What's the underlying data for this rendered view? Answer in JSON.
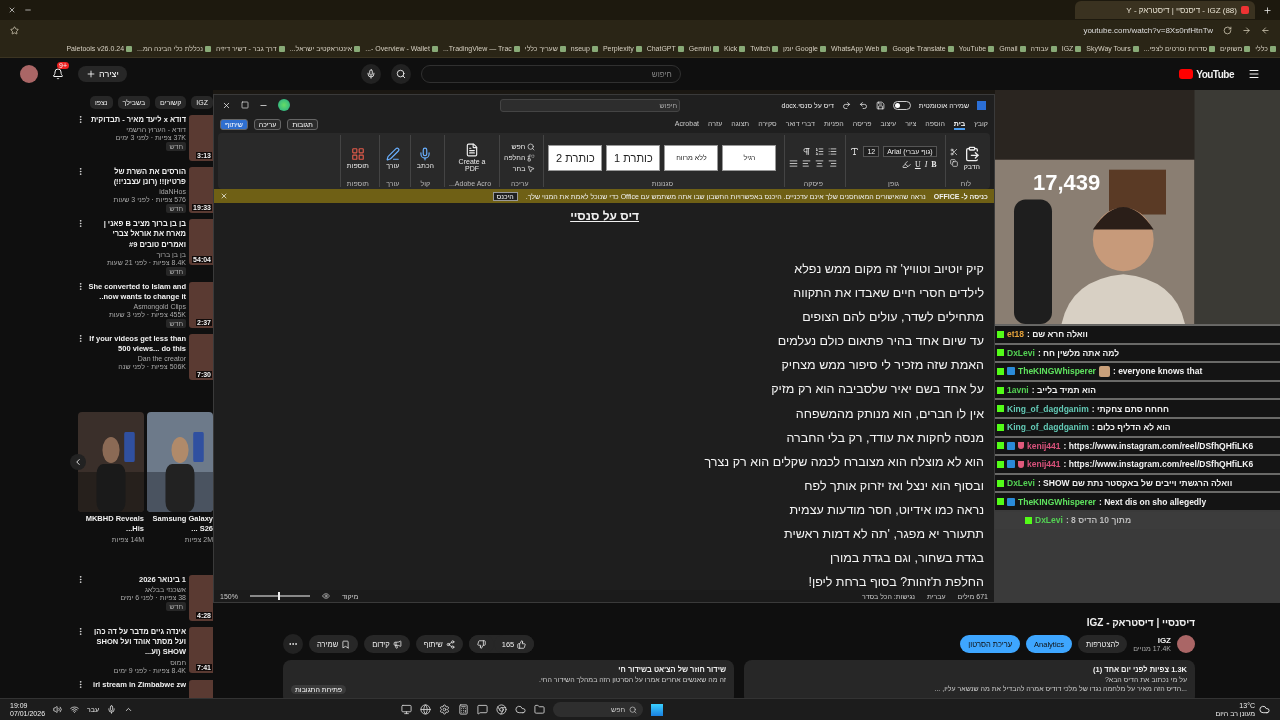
{
  "browser": {
    "tab_title": "(88) IGZ - דיסנסיי | דיסטראק - Y",
    "url": "youtube.com/watch?v=8Xs0nfHtnTw",
    "bookmarks": [
      "כללי",
      "משוקים",
      "סדרות וסרטים לצפי...",
      "SkyWay Tours",
      "IGZ",
      "עבודה",
      "Gmail",
      "YouTube",
      "Google Translate",
      "WhatsApp Web",
      "Google יומן",
      "Twitch",
      "Kick",
      "Gemini",
      "ChatGPT",
      "Perplexity",
      "nseup",
      "שעריך כללי",
      "TradingView — Trac...",
      "Overview - Wallet -...",
      "אינטראקטיב ישראל...",
      "דרך גבר - דשיר דיזיה",
      "נכללת כלי הבינה המ...",
      "Paletools v26.0.24"
    ]
  },
  "youtube_header": {
    "create_label": "יצירה",
    "notification_count": "9+",
    "search_placeholder": "חיפוש",
    "logo": "YouTube"
  },
  "sidebar": {
    "chips": [
      "IGZ",
      "קשורים",
      "בשבילך",
      "נצפו"
    ],
    "videos": [
      {
        "title": "דודא x ליעד מאיר - תבדוקית",
        "channel": "דודא - הערוץ הרשמי",
        "meta": "37K צפיות · לפני 3 ימים",
        "badge": "חדש",
        "duration": "3:13"
      },
      {
        "title": "הורסים את השרת של פרטיזן!! (רונן עצבני!!)",
        "channel": "idaNHos",
        "meta": "576 צפיות · לפני 3 שעות",
        "badge": "חדש",
        "duration": "19:33"
      },
      {
        "title": "בן בן ברוך מציב B פאני | מארח את אוראל צברי ואמרים טובים #9",
        "channel": "בן בן ברוך",
        "meta": "8.4K צפיות · לפני 21 שעות",
        "badge": "חדש",
        "duration": "54:04"
      },
      {
        "title": "She converted to Islam and now wants to change it..",
        "channel": "Asmongold Clips",
        "meta": "455K צפיות · לפני 3 שעות",
        "badge": "חדש",
        "duration": "2:37"
      },
      {
        "title": "If your videos get less than 500 views... do this",
        "channel": "Dan the creator",
        "meta": "506K צפיות · לפני שנה",
        "duration": "7:30"
      }
    ],
    "shorts": [
      {
        "title": "Samsung Galaxy S26 ...",
        "meta": "2M צפיות"
      },
      {
        "title": "MKBHD Reveals His...",
        "meta": "14M צפיות"
      }
    ],
    "videos_after": [
      {
        "title": "1 בינואר 2026",
        "channel": "אשכנזי בבלאג",
        "meta": "38 צפיות · לפני 6 ימים",
        "badge": "חדש",
        "duration": "4:28"
      },
      {
        "title": "אינדה גיים מדבר על דה כהן ועל מסתר אוהד ועל SHON SHOW (וע...",
        "channel": "חמוס",
        "meta": "8.4K צפיות · לפני 9 ימים",
        "duration": "7:41"
      },
      {
        "title": "irl stream in Zimbabwe zw"
      }
    ]
  },
  "word": {
    "autosave": {
      "label": "שמירה אוטומטית",
      "on": false
    },
    "file_name": "דיס על סנסי.docx",
    "search_placeholder": "חיפוש",
    "tabs": [
      {
        "label": "קובץ",
        "selected": false
      },
      {
        "label": "בית",
        "selected": true
      },
      {
        "label": "הוספה",
        "selected": false
      },
      {
        "label": "ציור",
        "selected": false
      },
      {
        "label": "עיצוב",
        "selected": false
      },
      {
        "label": "פריסה",
        "selected": false
      },
      {
        "label": "הפניות",
        "selected": false
      },
      {
        "label": "דברי דואר",
        "selected": false
      },
      {
        "label": "סקירה",
        "selected": false
      },
      {
        "label": "תצוגה",
        "selected": false
      },
      {
        "label": "עזרה",
        "selected": false
      },
      {
        "label": "Acrobat",
        "selected": false
      }
    ],
    "actions": [
      "תגובות",
      "עריכה",
      "שיתוף"
    ],
    "ribbon": {
      "paste": "הדבק",
      "clipboard": "לוח",
      "font_name": "(גוף עברי) Arial",
      "font_size": "12",
      "format_letters": [
        "B",
        "I",
        "U"
      ],
      "font": "גופן",
      "paragraph": "פיסקה",
      "styles": [
        "רגיל",
        "ללא מרווח",
        "כותרת 1",
        "כותרת 2"
      ],
      "styles_label": "סגנונות",
      "editing_buttons": [
        "חפש",
        "החלפה",
        "בחר"
      ],
      "editing": "עריכה",
      "pdf": "Create a PDF",
      "adobe": "Adobe Acro...",
      "dictate": "הכתב",
      "voice": "קול",
      "editor": "עורך",
      "editor_label": "עורך",
      "addins": "תוספות",
      "addins_label": "תוספות"
    },
    "message_bar": {
      "title": "כניסה ל- OFFICE",
      "text": "נראה שהאישורים המאוחסנים שלך אינם עדכניים. היכנס באפשרויות החשבון שבו אתה משתמש עם Office כדי שנוכל לאמת את המנוי שלך.",
      "button": "היכנס"
    },
    "document": {
      "title": "דיס על סנסיי",
      "lines": [
        "קיק יוטיוב וטוויץ' זה מקום ממש נפלא",
        "לילדים חסרי חיים שאבדו את התקווה",
        "מתחילים לשדר, עולים להם הצופים",
        "עד שיום אחד בהיר פתאום כולם נעלמים",
        "האמת שזה מזכיר לי סיפור ממש מצחיק",
        "על אחד בשם יאיר שלסביבה הוא רק מזיק",
        "אין לו חברים, הוא מנותק מהמשפחה",
        "מנסה לחקות את עודד, רק בלי החברה",
        "הוא לא מוצלח הוא מצוברח לכמה שקלים הוא רק נצרך",
        "ובסוף הוא ינצל ואז יזרוק אותך לפח",
        "נראה כמו אידיוט, חסר מודעות עצמית",
        "תתעורר יא מפגר, 'תה לא דמות ראשית",
        "בגדת בשחור, וגם בגדת במורן",
        "החלפת ת'זהות? בסוף ברחת ליפן!"
      ]
    },
    "status": {
      "words": "671 מילים",
      "language": "עברית",
      "accessibility": "נגישות: הכל בסדר",
      "focus": "מיקוד",
      "zoom": "150%",
      "zoom_slider": {
        "level": 0.5
      }
    }
  },
  "stream": {
    "counter": "17,439",
    "chat": [
      {
        "user": "et18",
        "color": "#e3a13a",
        "message": ": וואלה חרא שם",
        "badge": false,
        "shield": false,
        "emote": false,
        "highlighted": false
      },
      {
        "user": "DxLevi",
        "color": "#53d153",
        "message": ": למה אתה מלשין חח",
        "badge": false,
        "shield": false,
        "emote": false,
        "highlighted": false
      },
      {
        "user": "TheKINGWhisperer",
        "color": "#5fe35f",
        "message": ": everyone knows that",
        "badge": true,
        "shield": false,
        "emote": true,
        "highlighted": false
      },
      {
        "user": "1avni",
        "color": "#53d153",
        "message": ": הוא תמיד בלייב",
        "badge": false,
        "shield": false,
        "emote": false,
        "highlighted": false
      },
      {
        "user": "King_of_dagdganim",
        "color": "#63c9b5",
        "message": ": חחחח סתם צחקתי",
        "badge": false,
        "shield": false,
        "emote": false,
        "highlighted": false
      },
      {
        "user": "King_of_dagdganim",
        "color": "#63c9b5",
        "message": ": הוא לא הדליף כלום",
        "badge": false,
        "shield": false,
        "emote": false,
        "highlighted": false
      },
      {
        "user": "kenij441",
        "color": "#d9527c",
        "message": ": https://www.instagram.com/reel/DSfhQHfiLK6",
        "badge": true,
        "shield": true,
        "emote": false,
        "highlighted": false
      },
      {
        "user": "kenij441",
        "color": "#d9527c",
        "message": ": https://www.instagram.com/reel/DSfhQHfiLK6",
        "badge": true,
        "shield": true,
        "emote": false,
        "highlighted": false
      },
      {
        "user": "DxLevi",
        "color": "#53d153",
        "message": ": SHOW וואלה הרגשתי וייבים של באקסטר נתת שם",
        "badge": false,
        "shield": false,
        "emote": false,
        "highlighted": false
      },
      {
        "user": "TheKINGWhisperer",
        "color": "#5fe35f",
        "message": ": Next dis on sho allegedly",
        "badge": true,
        "shield": false,
        "emote": false,
        "highlighted": false
      },
      {
        "user": "DxLevi",
        "color": "#53d153",
        "message": ": מתוך 10 הדיס 8",
        "badge": false,
        "shield": false,
        "emote": false,
        "highlighted": true
      }
    ]
  },
  "video_info": {
    "title": "דיסנסיי | דיסטראק - IGZ",
    "channel": "IGZ",
    "subscribers": "17.4K מנויים",
    "join": "להצטרפות",
    "analytics": "Analytics",
    "edit": "עריכת הסרטון",
    "likes": "165",
    "share": "שיתוף",
    "promote": "קידום",
    "save": "שמירה",
    "description": {
      "meta": "1.3K צפיות  לפני יום אחד (1)",
      "line1": "על מי נכתוב את הדיס הבא?",
      "line2": "...הדיס הזה מאיר על מלחמה נגדו של מלכי דודיס אמרה להבדיל את מה שנשאר עליו, ..."
    },
    "chat_replay": {
      "title": "שידור חוזר של הצ'אט בשידור חי",
      "text": "זה מה שאנשים אחרים אמרו על הסרטון הזה במהלך השידור החי.",
      "button": "פתיחת התגובות"
    }
  },
  "taskbar": {
    "time": "19:09",
    "date": "07/01/2026",
    "language": "עבר",
    "search": "חפש",
    "temperature": "13°C",
    "weather": "מעונן רב היום"
  }
}
